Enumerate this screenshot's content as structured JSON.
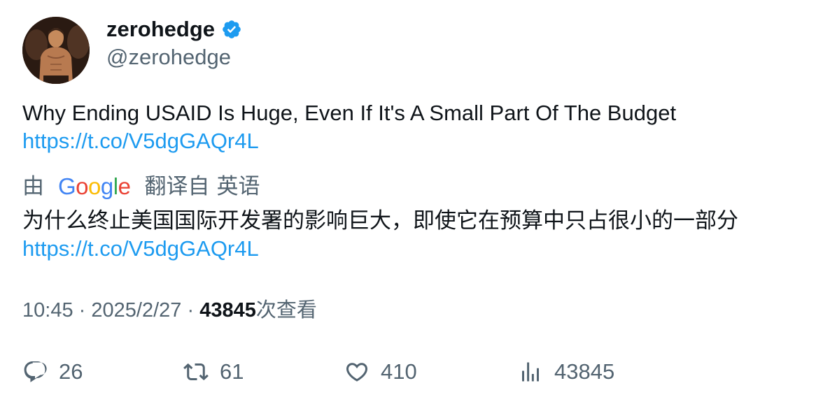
{
  "author": {
    "display_name": "zerohedge",
    "handle": "@zerohedge",
    "verified_icon": "verified-badge-icon",
    "verified_color": "#1d9bf0"
  },
  "tweet": {
    "text": "Why Ending USAID Is Huge, Even If It's A Small Part Of The Budget",
    "link": "https://t.co/V5dgGAQr4L"
  },
  "translation": {
    "prefix": "由",
    "provider_letters": [
      "G",
      "o",
      "o",
      "g",
      "l",
      "e"
    ],
    "suffix_1": "翻译自",
    "suffix_2": "英语",
    "text": "为什么终止美国国际开发署的影响巨大，即使它在预算中只占很小的一部分",
    "link": "https://t.co/V5dgGAQr4L"
  },
  "meta": {
    "time": "10:45",
    "separator": "·",
    "date": "2025/2/27",
    "views_count": "43845",
    "views_label": "次查看"
  },
  "actions": {
    "replies": "26",
    "retweets": "61",
    "likes": "410",
    "views": "43845"
  },
  "colors": {
    "link": "#1d9bf0",
    "secondary_text": "#536471",
    "primary_text": "#0f1419"
  }
}
